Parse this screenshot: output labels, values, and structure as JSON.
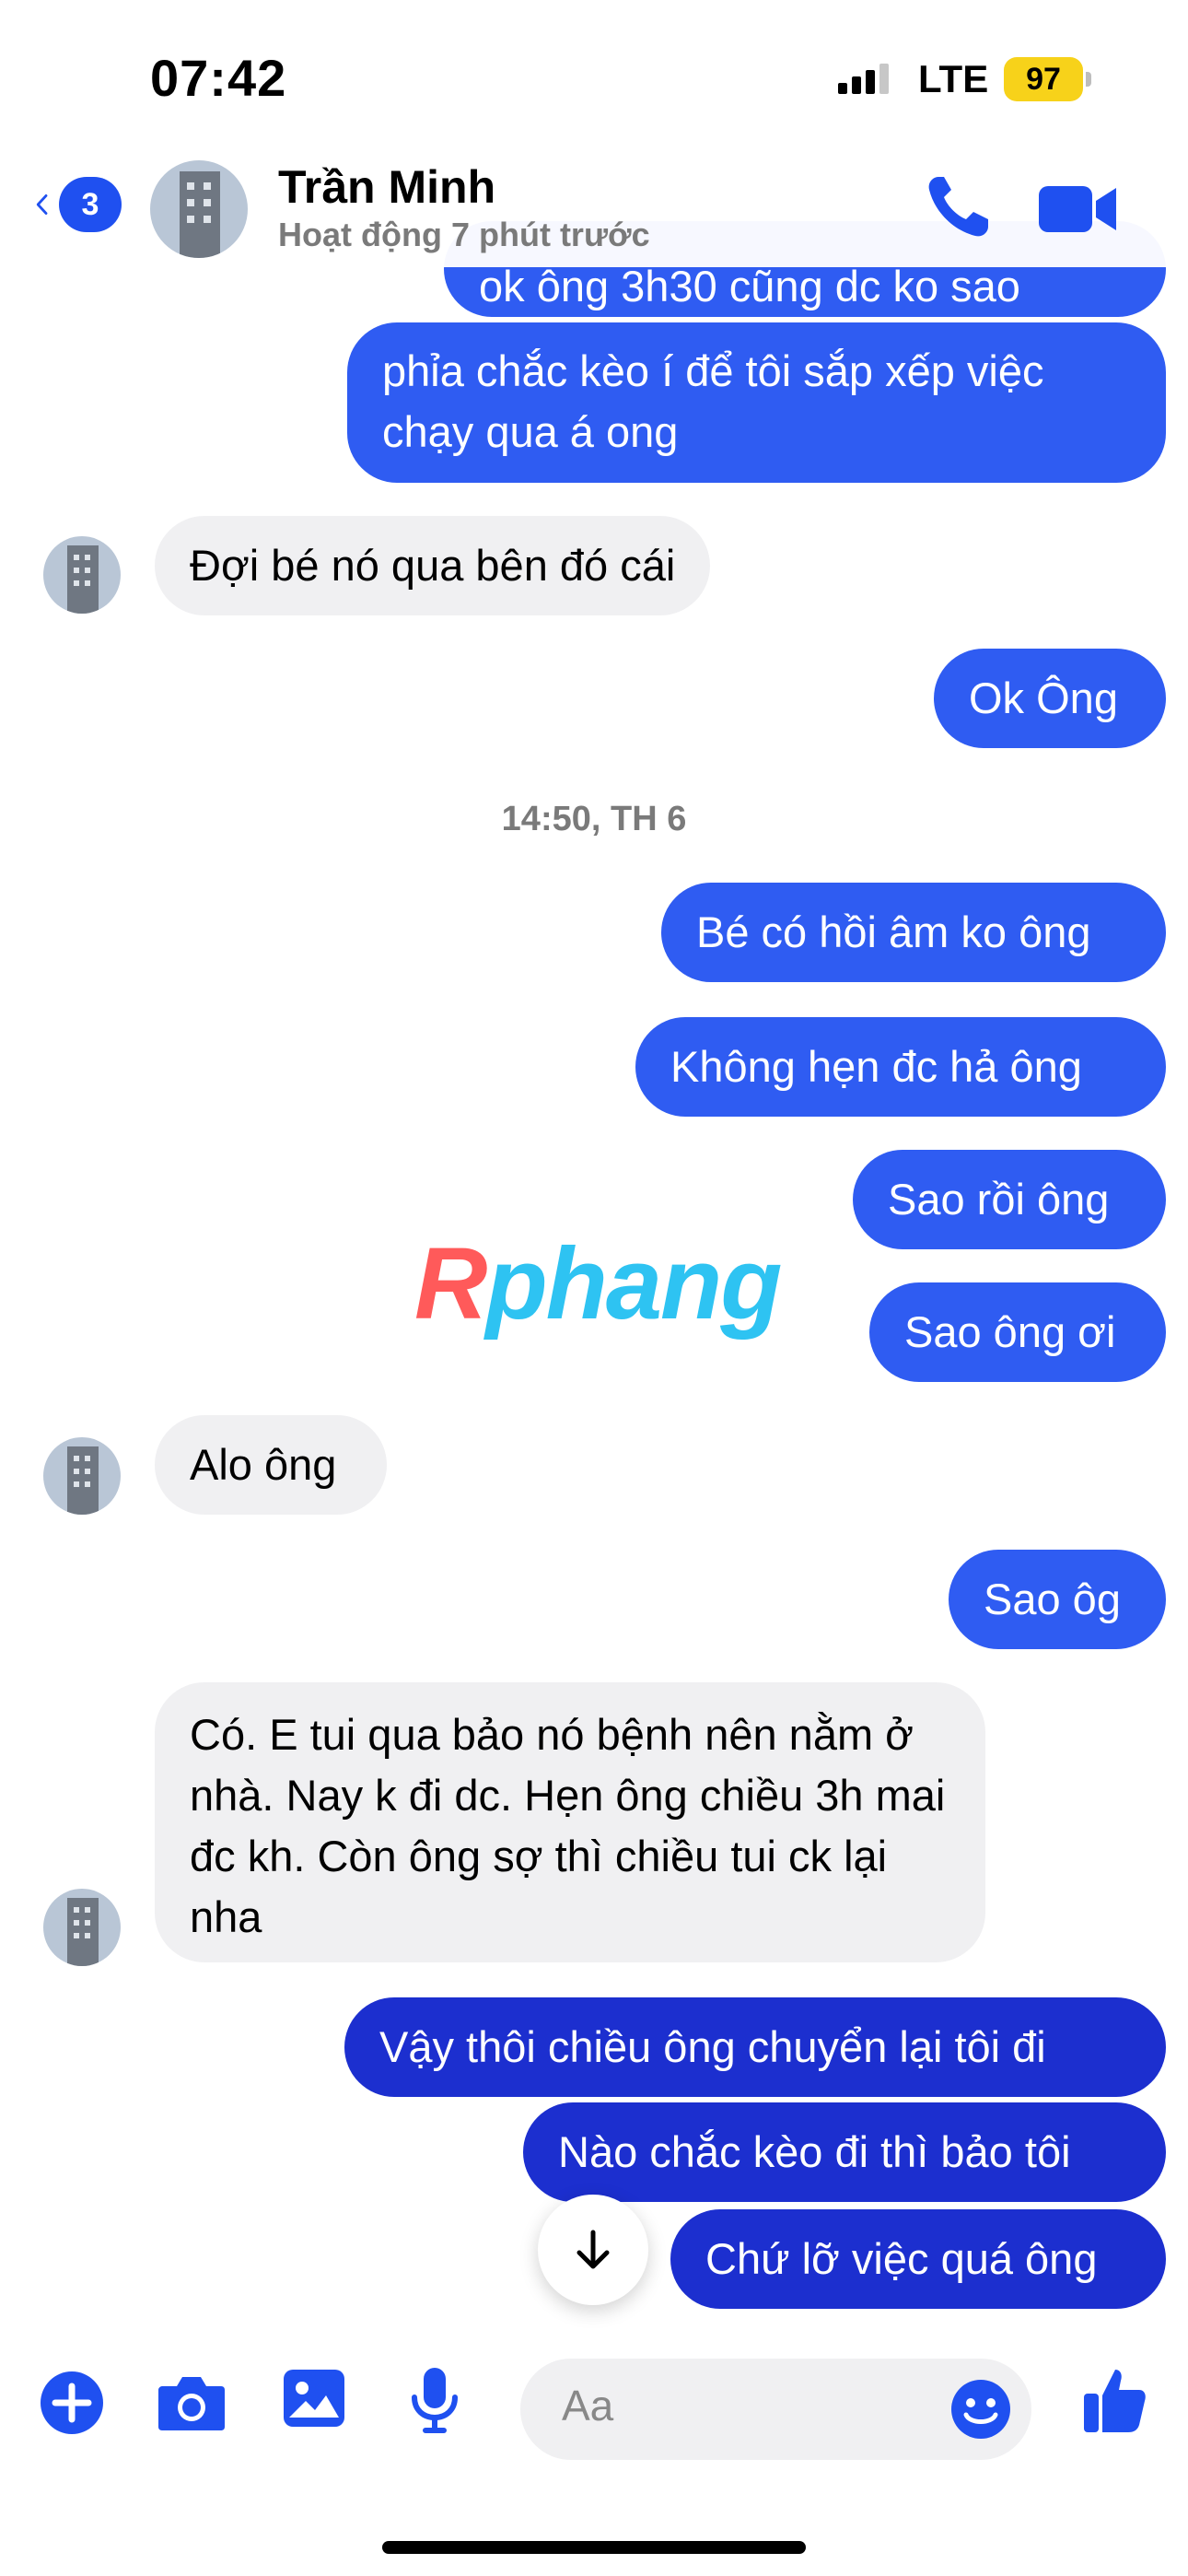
{
  "status": {
    "time": "07:42",
    "network": "LTE",
    "battery": "97"
  },
  "header": {
    "back_badge": "3",
    "name": "Trần Minh",
    "status": "Hoạt động 7 phút trước"
  },
  "messages": [
    {
      "text": "ok ông 3h30 cũng dc ko sao"
    },
    {
      "text": "phỉa chắc kèo í để tôi sắp xếp việc chạy qua á ong"
    },
    {
      "text": "Đợi bé nó qua bên đó cái"
    },
    {
      "text": "Ok Ông"
    },
    {
      "text": "Bé có hồi âm ko ông"
    },
    {
      "text": "Không hẹn đc hả ông"
    },
    {
      "text": "Sao rồi ông"
    },
    {
      "text": "Sao ông ơi"
    },
    {
      "text": "Alo ông"
    },
    {
      "text": "Sao ôg"
    },
    {
      "text": "Có. E tui qua bảo nó bệnh nên nằm ở nhà. Nay k đi dc. Hẹn ông chiều 3h mai đc kh. Còn ông sợ thì chiều tui ck lại nha"
    },
    {
      "text": "Vậy thôi chiều ông chuyển lại tôi đi"
    },
    {
      "text": "Nào chắc kèo đi thì bảo tôi"
    },
    {
      "text": "Chứ lỡ việc quá ông"
    }
  ],
  "timestamp": "14:50, TH 6",
  "watermark": {
    "part1": "R",
    "part2": "phang"
  },
  "composer": {
    "placeholder": "Aa"
  },
  "colors": {
    "accent": "#2f5cf2",
    "accent_dark": "#1c2fcf",
    "incoming": "#f0f0f2"
  }
}
